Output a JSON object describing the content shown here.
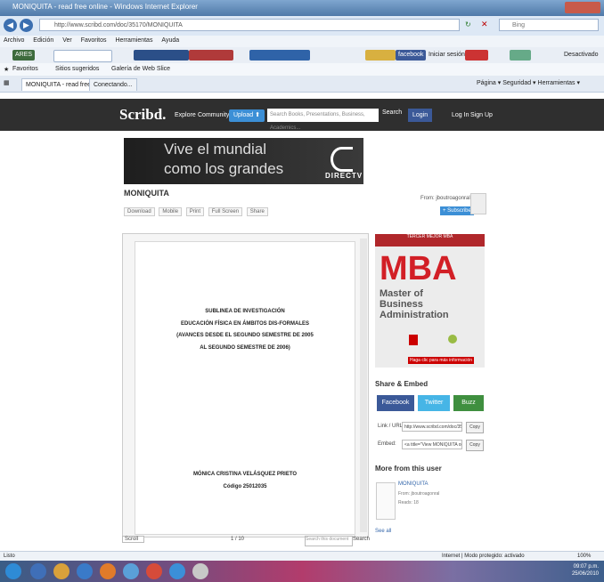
{
  "window": {
    "title": "MONIQUITA - read free online - Windows Internet Explorer",
    "url": "http://www.scribd.com/doc/35170/MONIQUITA",
    "search_placeholder": "Bing"
  },
  "menu": [
    "Archivo",
    "Edición",
    "Ver",
    "Favoritos",
    "Herramientas",
    "Ayuda"
  ],
  "toolbar": {
    "ares": "ARES",
    "facebook": "facebook",
    "iniciar": "Iniciar sesión",
    "desactivado": "Desactivado"
  },
  "favbar": {
    "favoritos": "Favoritos",
    "sitios": "Sitios sugeridos",
    "galeria": "Galería de Web Slice"
  },
  "tabs": [
    "MONIQUITA - read free ...",
    "Conectando..."
  ],
  "ie_cmdbar": "Página ▾  Seguridad ▾  Herramientas ▾",
  "scribd": {
    "logo": "Scribd.",
    "explore": "Explore",
    "community": "Community",
    "upload": "Upload ⬆",
    "search_placeholder": "Search Books, Presentations, Business, Academics...",
    "search_btn": "Search",
    "login_fb": "Login",
    "login": "Log In",
    "signup": "Sign Up"
  },
  "ad": {
    "line1": "Vive el mundial",
    "line2": "como los grandes",
    "brand": "DIRECTV"
  },
  "doc": {
    "title": "MONIQUITA",
    "actions": [
      "Download",
      "Mobile",
      "Print",
      "Full Screen",
      "Share"
    ],
    "from": "From: jboutroagonral",
    "subscribe": "+ Subscribe",
    "line1": "SUBLINEA DE INVESTIGACIÓN",
    "line2": "EDUCACIÓN FÍSICA EN ÁMBITOS DIS-FORMALES",
    "line3": "(AVANCES DESDE EL SEGUNDO SEMESTRE DE 2005",
    "line4": "AL SEGUNDO SEMESTRE DE 2006)",
    "author": "MÓNICA CRISTINA VELÁSQUEZ PRIETO",
    "code": "Código 25012035",
    "view_mode": "Scroll",
    "page_counter": "1 / 10",
    "search_doc": "Search this document",
    "search_doc_btn": "Search"
  },
  "sidebar": {
    "ad_top": "TERCER MEJOR MBA",
    "mba": "MBA",
    "mba_sub1": "Master of",
    "mba_sub2": "Business",
    "mba_sub3": "Administration",
    "ad_click": "Haga clic para más información",
    "share_title": "Share & Embed",
    "facebook": "Facebook",
    "twitter": "Twitter",
    "buzz": "Buzz",
    "link_label": "Link / URL:",
    "link_value": "http://www.scribd.com/doc/35137",
    "embed_label": "Embed:",
    "embed_value": "<a title=\"View MONIQUITA on Scrib",
    "copy": "Copy",
    "more_title": "More from this user",
    "user_doc": "MONIQUITA",
    "user_from": "From: jboutroagonral",
    "user_reads": "Reads: 18",
    "see_all": "See all"
  },
  "status": {
    "left": "Listo",
    "zone": "Internet | Modo protegido: activado",
    "zoom": "100%"
  },
  "clock": {
    "time": "09:07 p.m.",
    "date": "25/06/2010"
  }
}
